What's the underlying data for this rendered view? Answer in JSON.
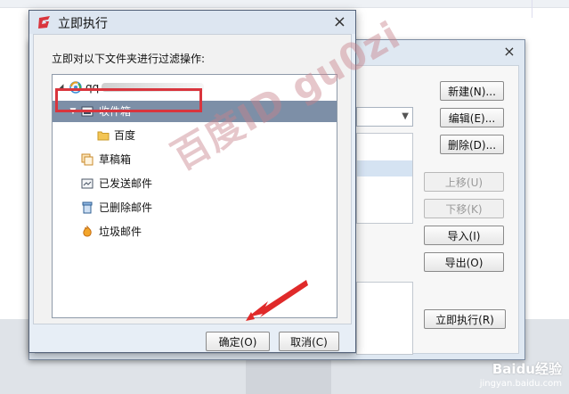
{
  "dialog": {
    "title": "立即执行",
    "close_glyph": "×",
    "instruction": "立即对以下文件夹进行过滤操作:",
    "ok_label": "确定(O)",
    "cancel_label": "取消(C)"
  },
  "tree": {
    "account_prefix": "qq",
    "folders": [
      {
        "label": "收件箱",
        "icon": "inbox-icon",
        "selected": true,
        "expanded": true
      },
      {
        "label": "百度",
        "icon": "folder-icon",
        "selected": false
      },
      {
        "label": "草稿箱",
        "icon": "drafts-icon",
        "selected": false
      },
      {
        "label": "已发送邮件",
        "icon": "sent-icon",
        "selected": false
      },
      {
        "label": "已删除邮件",
        "icon": "trash-icon",
        "selected": false
      },
      {
        "label": "垃圾邮件",
        "icon": "spam-icon",
        "selected": false
      }
    ]
  },
  "back_window": {
    "close_glyph": "×",
    "buttons": {
      "new": "新建(N)...",
      "edit": "编辑(E)...",
      "delete": "删除(D)...",
      "up": "上移(U)",
      "down": "下移(K)",
      "import": "导入(I)",
      "export": "导出(O)",
      "run_now": "立即执行(R)"
    }
  },
  "watermark": "百度ID gu0zi",
  "baidu_badge": {
    "brand": "Baidu经验",
    "url": "jingyan.baidu.com"
  },
  "colors": {
    "selection": "#7d8fa7",
    "highlight_box": "#d9353d",
    "arrow": "#e02a2a",
    "logo": "#d9353d"
  }
}
